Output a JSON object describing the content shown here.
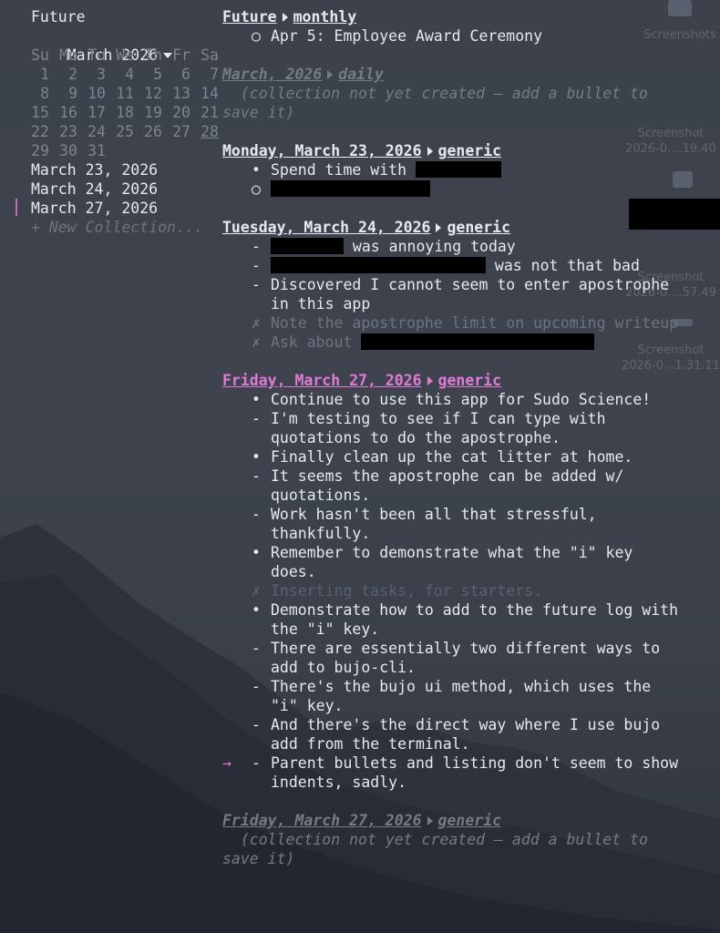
{
  "sidebar": {
    "future_label": "Future",
    "month_label": "March 2026",
    "weekdays": [
      "Su",
      "Mo",
      "Tu",
      "We",
      "Th",
      "Fr",
      "Sa"
    ],
    "weeks": [
      [
        "1",
        "2",
        "3",
        "4",
        "5",
        "6",
        "7"
      ],
      [
        "8",
        "9",
        "10",
        "11",
        "12",
        "13",
        "14"
      ],
      [
        "15",
        "16",
        "17",
        "18",
        "19",
        "20",
        "21"
      ],
      [
        "22",
        "23",
        "24",
        "25",
        "26",
        "27",
        "28"
      ],
      [
        "29",
        "30",
        "31",
        "",
        "",
        "",
        ""
      ]
    ],
    "today": "28",
    "collections": [
      "March 23, 2026",
      "March 24, 2026",
      "March 27, 2026"
    ],
    "selected_index": 2,
    "new_collection": "+ New Collection..."
  },
  "sections": [
    {
      "title_a": "Future",
      "title_b": "monthly",
      "style": "normal",
      "entries": [
        {
          "bullet": "○",
          "text": "Apr 5: Employee Award Ceremony"
        }
      ]
    },
    {
      "title_a": "March, 2026",
      "title_b": "daily",
      "style": "empty",
      "note": "  (collection not yet created — add a bullet to save it)"
    },
    {
      "title_a": "Monday, March 23, 2026",
      "title_b": "generic",
      "style": "normal",
      "entries": [
        {
          "bullet": "•",
          "text": "Spend time with ",
          "redact_after": 94
        },
        {
          "bullet": "○",
          "text": "",
          "redact_after": 175
        }
      ]
    },
    {
      "title_a": "Tuesday, March 24, 2026",
      "title_b": "generic",
      "style": "normal",
      "entries": [
        {
          "bullet": "-",
          "text": " was annoying today",
          "redact_before": 80
        },
        {
          "bullet": "-",
          "text": " was not that bad",
          "redact_before": 236
        },
        {
          "bullet": "-",
          "text": "Discovered I cannot seem to enter apostrophe in this app"
        },
        {
          "bullet": "✗",
          "text": "Note the apostrophe limit on upcoming writeup",
          "done": true
        },
        {
          "bullet": "✗",
          "text": "Ask about ",
          "redact_after": 256,
          "done": true
        }
      ]
    },
    {
      "title_a": "Friday, March 27, 2026",
      "title_b": "generic",
      "style": "active",
      "entries": [
        {
          "bullet": "•",
          "text": "Continue to use this app for Sudo Science!"
        },
        {
          "bullet": "-",
          "text": "I'm testing to see if I can type with quotations to do the apostrophe."
        },
        {
          "bullet": "•",
          "text": "Finally clean up the cat litter at home."
        },
        {
          "bullet": "-",
          "text": "It seems the apostrophe can be added w/ quotations."
        },
        {
          "bullet": "-",
          "text": "Work hasn't been all that stressful, thankfully."
        },
        {
          "bullet": "•",
          "text": "Remember to demonstrate what the \"i\" key does."
        },
        {
          "bullet": "✗",
          "text": "Inserting tasks, for starters.",
          "done": true,
          "faint": true
        },
        {
          "bullet": "•",
          "text": "Demonstrate how to add to the future log with the \"i\" key."
        },
        {
          "bullet": "-",
          "text": "There are essentially two different ways to add to bujo-cli."
        },
        {
          "bullet": "-",
          "text": "There's the bujo ui method, which uses the \"i\" key."
        },
        {
          "bullet": "-",
          "text": "And there's the direct way where I use bujo add from the terminal."
        },
        {
          "bullet": "-",
          "text": "Parent bullets and listing don't seem to show indents, sadly.",
          "pointer": "→"
        }
      ]
    },
    {
      "title_a": "Friday, March 27, 2026",
      "title_b": "generic",
      "style": "empty",
      "note": "  (collection not yet created — add a bullet to save it)"
    }
  ],
  "desktop": {
    "items": [
      {
        "label": "Screenshots"
      },
      {
        "label": "Screenshot\n2026-0....19.40"
      },
      {
        "label": "Screenshot\n2026-0....57.49"
      },
      {
        "label": "Screenshot\n2026-0...1.31.11"
      }
    ]
  },
  "colors": {
    "accent": "#e07ad8",
    "text": "#e7e9ec",
    "muted": "#747b87",
    "background": "#3d424c"
  }
}
